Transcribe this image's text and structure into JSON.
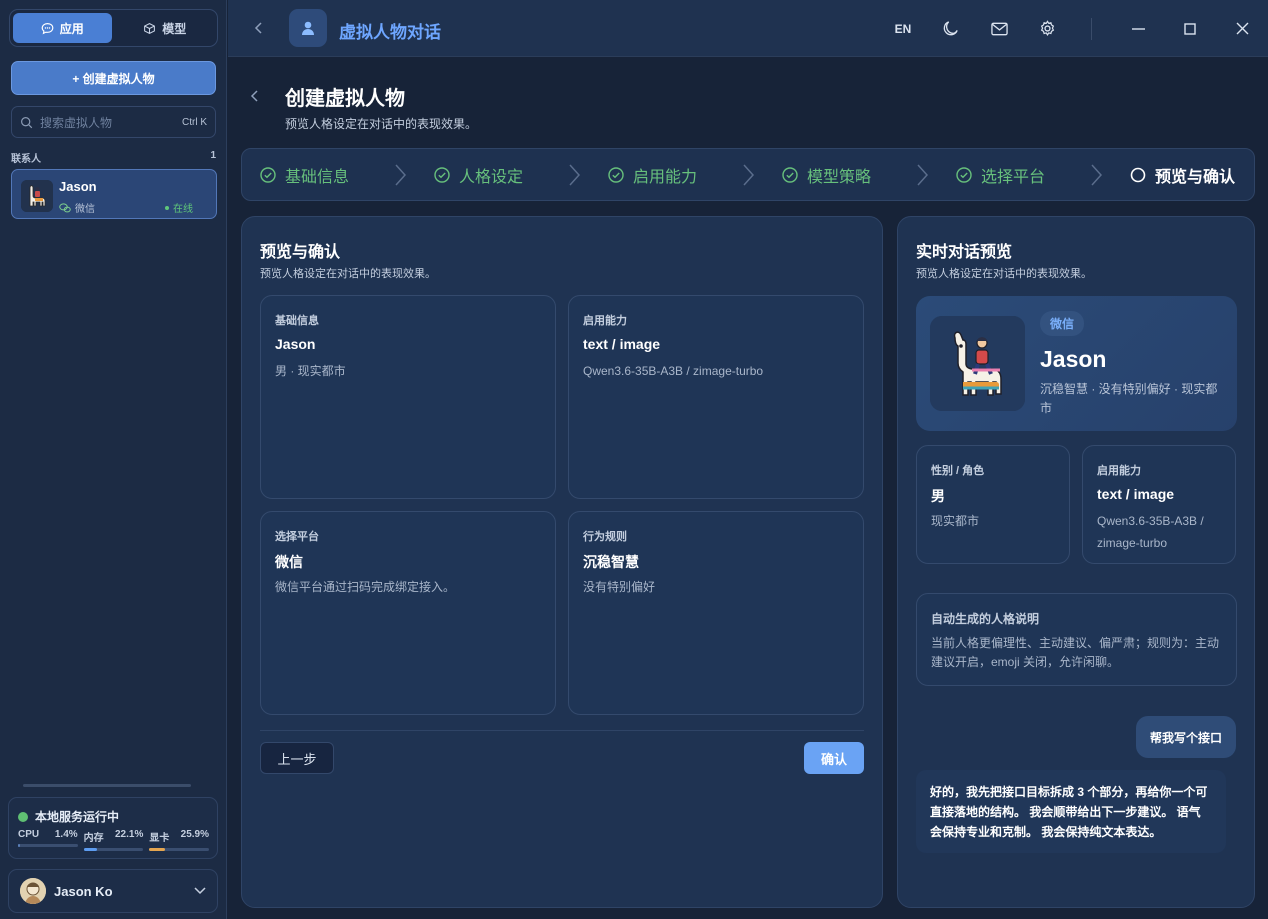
{
  "sidebar": {
    "tabs": [
      {
        "label": "应用",
        "icon": "chat-icon",
        "active": true
      },
      {
        "label": "模型",
        "icon": "box-icon",
        "active": false
      }
    ],
    "create_button": "+ 创建虚拟人物",
    "search": {
      "placeholder": "搜索虚拟人物",
      "shortcut": "Ctrl K"
    },
    "contacts_header": "联系人",
    "contacts_count": "1",
    "contacts": [
      {
        "name": "Jason",
        "platform": "微信",
        "status": "在线"
      }
    ],
    "service": {
      "title": "本地服务运行中",
      "metrics": [
        {
          "label": "CPU",
          "value": "1.4%",
          "fraction": 0.014,
          "color": "#5a7fb8"
        },
        {
          "label": "内存",
          "value": "22.1%",
          "fraction": 0.221,
          "color": "#5d9cf0"
        },
        {
          "label": "显卡",
          "value": "25.9%",
          "fraction": 0.259,
          "color": "#e4a550"
        }
      ]
    },
    "user": {
      "name": "Jason Ko"
    }
  },
  "topbar": {
    "title": "虚拟人物对话",
    "lang": "EN",
    "icons": [
      "moon-icon",
      "mail-icon",
      "settings-icon",
      "minimize-icon",
      "maximize-icon",
      "close-icon"
    ]
  },
  "page": {
    "title": "创建虚拟人物",
    "subtitle": "预览人格设定在对话中的表现效果。",
    "steps": [
      {
        "label": "基础信息",
        "done": true
      },
      {
        "label": "人格设定",
        "done": true
      },
      {
        "label": "启用能力",
        "done": true
      },
      {
        "label": "模型策略",
        "done": true
      },
      {
        "label": "选择平台",
        "done": true
      },
      {
        "label": "预览与确认",
        "done": false
      }
    ]
  },
  "preview": {
    "title": "预览与确认",
    "subtitle": "预览人格设定在对话中的表现效果。",
    "cards": [
      {
        "key": "基础信息",
        "value": "Jason",
        "desc": "男 · 现实都市"
      },
      {
        "key": "启用能力",
        "value": "text / image",
        "desc": "Qwen3.6-35B-A3B / zimage-turbo"
      },
      {
        "key": "选择平台",
        "value": "微信",
        "desc": "微信平台通过扫码完成绑定接入。"
      },
      {
        "key": "行为规则",
        "value": "沉稳智慧",
        "desc": "没有特别偏好"
      }
    ],
    "prev_button": "上一步",
    "confirm_button": "确认"
  },
  "live": {
    "title": "实时对话预览",
    "subtitle": "预览人格设定在对话中的表现效果。",
    "badge": "微信",
    "name": "Jason",
    "desc": "沉稳智慧 · 没有特别偏好 · 现实都市",
    "cards": [
      {
        "key": "性别 / 角色",
        "value": "男",
        "desc": "现实都市"
      },
      {
        "key": "启用能力",
        "value": "text / image",
        "desc": "Qwen3.6-35B-A3B / zimage-turbo"
      }
    ],
    "note_title": "自动生成的人格说明",
    "note_text": "当前人格更偏理性、主动建议、偏严肃；规则为：主动建议开启，emoji 关闭，允许闲聊。",
    "user_message": "帮我写个接口",
    "bot_message": "好的，我先把接口目标拆成 3 个部分，再给你一个可直接落地的结构。 我会顺带给出下一步建议。 语气会保持专业和克制。 我会保持纯文本表达。"
  },
  "colors": {
    "accent": "#4a7fd4",
    "success": "#67c07c",
    "link": "#6ea6ff"
  }
}
